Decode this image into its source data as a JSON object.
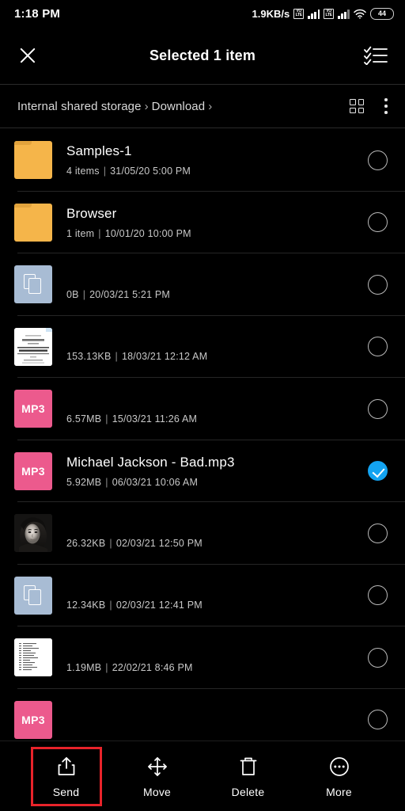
{
  "status_bar": {
    "time": "1:18 PM",
    "network_speed": "1.9KB/s",
    "volte_label_top": "VO",
    "volte_label_bottom": "LTE",
    "battery_level": "44",
    "icons": [
      "volte-icon",
      "signal-bars-icon",
      "volte-icon",
      "signal-bars-icon",
      "wifi-icon",
      "battery-icon"
    ]
  },
  "action_bar": {
    "close_icon": "close-icon",
    "title": "Selected 1 item",
    "select_all_icon": "select-all-checklist-icon"
  },
  "breadcrumb": {
    "root": "Internal shared storage",
    "separator": "›",
    "current": "Download",
    "trailing_separator": "›",
    "grid_view_icon": "grid-view-icon",
    "overflow_icon": "overflow-menu-icon"
  },
  "files": [
    {
      "name": "Samples-1",
      "name_visible": true,
      "size": "4 items",
      "date": "31/05/20 5:00 PM",
      "icon": "folder-icon",
      "icon_type": "folder",
      "selected": false
    },
    {
      "name": "Browser",
      "name_visible": true,
      "size": "1 item",
      "date": "10/01/20 10:00 PM",
      "icon": "folder-icon",
      "icon_type": "folder",
      "selected": false
    },
    {
      "name": "",
      "name_visible": false,
      "size": "0B",
      "date": "20/03/21 5:21 PM",
      "icon": "document-icon",
      "icon_type": "doc",
      "selected": false
    },
    {
      "name": "",
      "name_visible": false,
      "size": "153.13KB",
      "date": "18/03/21 12:12 AM",
      "icon": "document-thumbnail",
      "icon_type": "certificate",
      "selected": false
    },
    {
      "name": "",
      "name_visible": false,
      "size": "6.57MB",
      "date": "15/03/21 11:26 AM",
      "icon": "mp3-icon",
      "icon_type": "mp3",
      "icon_label": "MP3",
      "selected": false
    },
    {
      "name": "Michael Jackson - Bad.mp3",
      "name_visible": true,
      "size": "5.92MB",
      "date": "06/03/21 10:06 AM",
      "icon": "mp3-icon",
      "icon_type": "mp3",
      "icon_label": "MP3",
      "selected": true
    },
    {
      "name": "",
      "name_visible": false,
      "size": "26.32KB",
      "date": "02/03/21 12:50 PM",
      "icon": "photo-thumbnail",
      "icon_type": "photo",
      "selected": false
    },
    {
      "name": "",
      "name_visible": false,
      "size": "12.34KB",
      "date": "02/03/21 12:41 PM",
      "icon": "document-icon",
      "icon_type": "doc",
      "selected": false
    },
    {
      "name": "",
      "name_visible": false,
      "size": "1.19MB",
      "date": "22/02/21 8:46 PM",
      "icon": "spreadsheet-thumbnail",
      "icon_type": "sheet",
      "selected": false
    },
    {
      "name": "",
      "name_visible": false,
      "size": "",
      "date": "",
      "icon": "mp3-icon",
      "icon_type": "mp3",
      "icon_label": "MP3",
      "selected": false,
      "cut_off": true
    }
  ],
  "separator_glyph": "|",
  "bottom_bar": {
    "items": [
      {
        "label": "Send",
        "icon": "share-upload-icon",
        "highlighted": true
      },
      {
        "label": "Move",
        "icon": "move-arrows-icon",
        "highlighted": false
      },
      {
        "label": "Delete",
        "icon": "trash-icon",
        "highlighted": false
      },
      {
        "label": "More",
        "icon": "more-dots-circle-icon",
        "highlighted": false
      }
    ]
  },
  "colors": {
    "background": "#000000",
    "folder": "#f5b54a",
    "mp3": "#ec5a8d",
    "doc": "#a8bcd4",
    "accent_selected": "#13a3f1",
    "highlight_box": "#e8232a",
    "text_primary": "#ffffff",
    "text_secondary": "#c8c8c8"
  }
}
